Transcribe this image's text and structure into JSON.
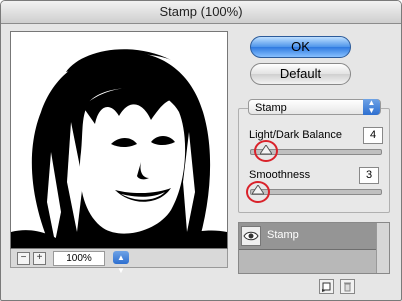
{
  "window": {
    "title": "Stamp (100%)"
  },
  "preview": {
    "zoom_value": "100%",
    "zoom_out_icon": "minus-icon",
    "zoom_in_icon": "plus-icon"
  },
  "buttons": {
    "ok_label": "OK",
    "default_label": "Default"
  },
  "filter": {
    "selected": "Stamp",
    "params": [
      {
        "label": "Light/Dark Balance",
        "value": "4",
        "max": 50
      },
      {
        "label": "Smoothness",
        "value": "3",
        "max": 50
      }
    ]
  },
  "layers": [
    {
      "name": "Stamp",
      "visible": true
    }
  ],
  "colors": {
    "highlight_ring": "#d9222a",
    "ok_button": "#2f7ae0",
    "layer_row": "#959595"
  }
}
